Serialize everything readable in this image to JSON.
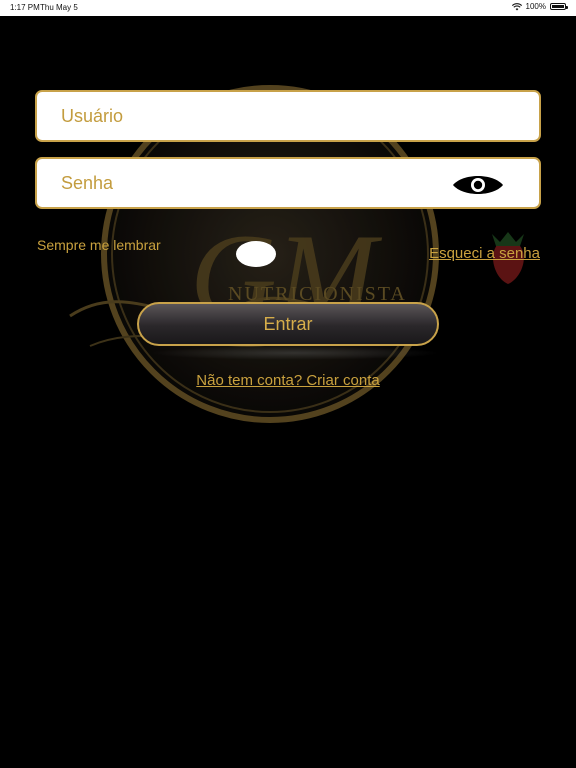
{
  "status_bar": {
    "time": "1:17 PM",
    "date": "Thu May 5",
    "battery_percent": "100%",
    "icons": [
      "wifi-icon",
      "battery-icon"
    ]
  },
  "logo": {
    "text": "NUTRICIONISTA",
    "monogram": "GM"
  },
  "form": {
    "username_placeholder": "Usuário",
    "password_placeholder": "Senha",
    "password_toggle_icon": "eye-icon",
    "remember_me_label": "Sempre me lembrar",
    "remember_me_on": false,
    "forgot_password_link": "Esqueci a senha",
    "login_button": "Entrar",
    "signup_link": "Não tem conta? Criar conta"
  },
  "colors": {
    "background": "#000000",
    "accent_gold": "#c9a13e",
    "field_background": "#ffffff"
  }
}
